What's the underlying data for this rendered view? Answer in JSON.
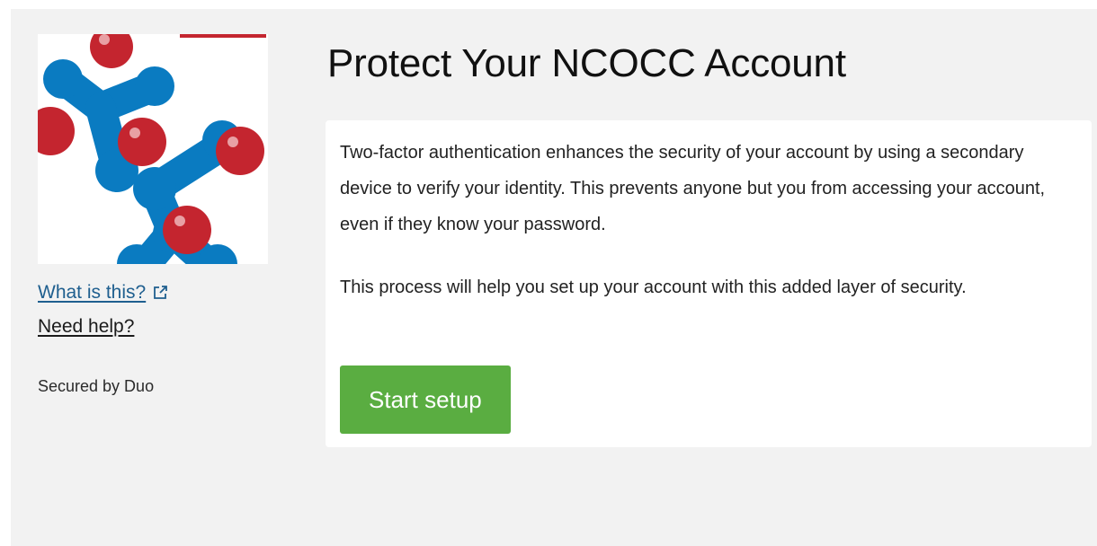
{
  "brand": {
    "logo_icon": "ncocc-molecule-logo-icon",
    "colors": {
      "red": "#c4252f",
      "blue": "#0a7bc1"
    }
  },
  "sidebar": {
    "what_link": "What is this?",
    "what_link_icon": "external-link-icon",
    "help_link": "Need help?",
    "secured_text": "Secured by Duo"
  },
  "main": {
    "title": "Protect Your NCOCC Account",
    "paragraph1": "Two-factor authentication enhances the security of your account by using a secondary device to verify your identity. This prevents anyone but you from accessing your account, even if they know your password.",
    "paragraph2": "This process will help you set up your account with this added layer of security.",
    "start_button": "Start setup",
    "start_button_color": "#5aad41"
  }
}
